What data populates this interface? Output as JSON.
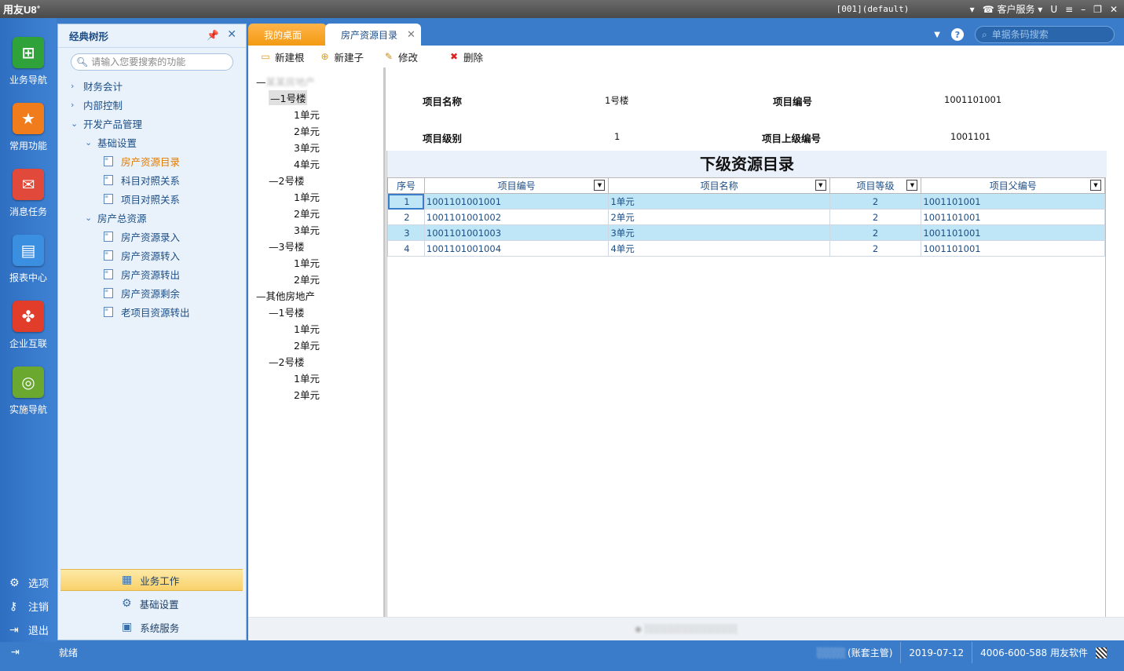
{
  "app": {
    "logo": "用友U8",
    "logo_sup": "+"
  },
  "titlebar": {
    "account": "[001](default)",
    "customer_service": "客户服务"
  },
  "left_nav": {
    "items": [
      {
        "label": "业务导航",
        "icon": "business-nav-icon",
        "color": "#2fa33a"
      },
      {
        "label": "常用功能",
        "icon": "star-icon",
        "color": "#f07c1c"
      },
      {
        "label": "消息任务",
        "icon": "mail-icon",
        "color": "#e14a3a"
      },
      {
        "label": "报表中心",
        "icon": "report-icon",
        "color": "#3b8fe0"
      },
      {
        "label": "企业互联",
        "icon": "connect-icon",
        "color": "#e23c2a"
      },
      {
        "label": "实施导航",
        "icon": "compass-icon",
        "color": "#6aa82f"
      }
    ],
    "bottom": [
      {
        "label": "选项",
        "icon": "gear-icon"
      },
      {
        "label": "注销",
        "icon": "key-icon"
      },
      {
        "label": "退出",
        "icon": "exit-icon"
      }
    ]
  },
  "tree_panel": {
    "title": "经典树形",
    "search_placeholder": "请输入您要搜索的功能",
    "nodes": [
      {
        "label": "财务会计",
        "type": "collapsed"
      },
      {
        "label": "内部控制",
        "type": "collapsed"
      },
      {
        "label": "开发产品管理",
        "type": "expanded"
      },
      {
        "label": "基础设置",
        "type": "expanded"
      },
      {
        "label": "房产资源目录",
        "type": "leaf",
        "active": true
      },
      {
        "label": "科目对照关系",
        "type": "leaf"
      },
      {
        "label": "项目对照关系",
        "type": "leaf"
      },
      {
        "label": "房产总资源",
        "type": "expanded"
      },
      {
        "label": "房产资源录入",
        "type": "leaf"
      },
      {
        "label": "房产资源转入",
        "type": "leaf"
      },
      {
        "label": "房产资源转出",
        "type": "leaf"
      },
      {
        "label": "房产资源剩余",
        "type": "leaf"
      },
      {
        "label": "老项目资源转出",
        "type": "leaf"
      }
    ],
    "bottom_items": [
      {
        "label": "业务工作",
        "selected": true
      },
      {
        "label": "基础设置",
        "selected": false
      },
      {
        "label": "系统服务",
        "selected": false
      }
    ]
  },
  "tabs": {
    "desktop": "我的桌面",
    "active": "房产资源目录",
    "search_placeholder": "单据条码搜索"
  },
  "toolbar": {
    "new_root": "新建根",
    "new_child": "新建子",
    "edit": "修改",
    "delete": "删除"
  },
  "resource_tree": [
    {
      "label": "—",
      "blur": "某某房地产"
    },
    {
      "label": "—1号楼",
      "selected": true
    },
    {
      "label": "1单元"
    },
    {
      "label": "2单元"
    },
    {
      "label": "3单元"
    },
    {
      "label": "4单元"
    },
    {
      "label": "—2号楼"
    },
    {
      "label": "1单元"
    },
    {
      "label": "2单元"
    },
    {
      "label": "3单元"
    },
    {
      "label": "—3号楼"
    },
    {
      "label": "1单元"
    },
    {
      "label": "2单元"
    },
    {
      "label": "—其他房地产"
    },
    {
      "label": "—1号楼"
    },
    {
      "label": "1单元"
    },
    {
      "label": "2单元"
    },
    {
      "label": "—2号楼"
    },
    {
      "label": "1单元"
    },
    {
      "label": "2单元"
    }
  ],
  "detail": {
    "name_label": "项目名称",
    "name_value": "1号楼",
    "code_label": "项目编号",
    "code_value": "1001101001",
    "level_label": "项目级别",
    "level_value": "1",
    "parent_label": "项目上级编号",
    "parent_value": "1001101"
  },
  "grid": {
    "title": "下级资源目录",
    "columns": [
      "序号",
      "项目编号",
      "项目名称",
      "项目等级",
      "项目父编号"
    ],
    "rows": [
      [
        "1",
        "1001101001001",
        "1单元",
        "2",
        "1001101001"
      ],
      [
        "2",
        "1001101001002",
        "2单元",
        "2",
        "1001101001"
      ],
      [
        "3",
        "1001101001003",
        "3单元",
        "2",
        "1001101001"
      ],
      [
        "4",
        "1001101001004",
        "4单元",
        "2",
        "1001101001"
      ]
    ]
  },
  "statusbar": {
    "ready": "就绪",
    "role": "(账套主管)",
    "date": "2019-07-12",
    "vendor": "4006-600-588 用友软件"
  }
}
